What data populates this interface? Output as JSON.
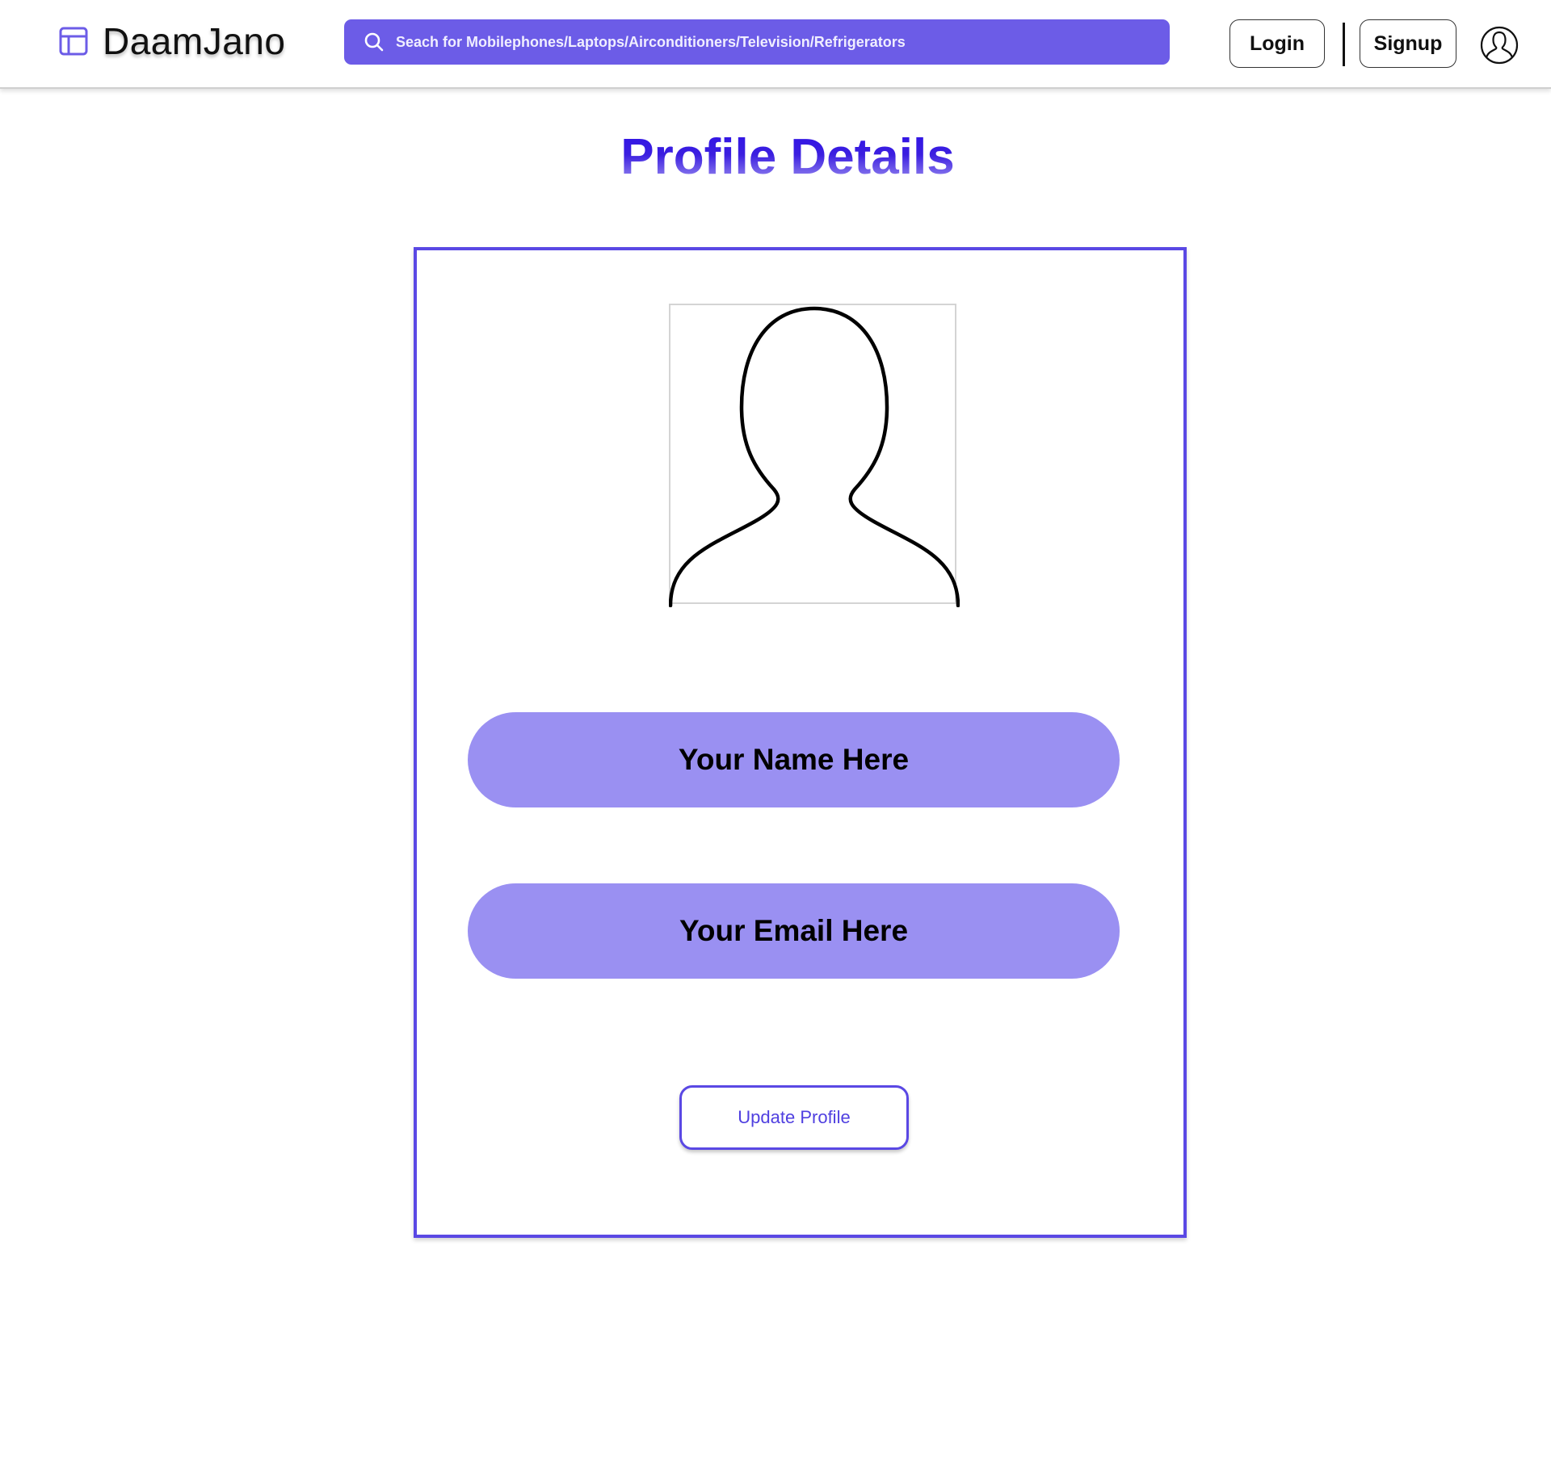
{
  "header": {
    "brand": "DaamJano",
    "brand_icon": "layout-panel-icon",
    "search": {
      "placeholder": "Seach for Mobilephones/Laptops/Airconditioners/Television/Refrigerators",
      "value": "",
      "icon": "search-icon"
    },
    "login_label": "Login",
    "signup_label": "Signup",
    "account_icon": "user-circle-icon"
  },
  "main": {
    "title": "Profile Details",
    "avatar_icon": "user-silhouette-icon",
    "name_value": "Your Name Here",
    "email_value": "Your Email Here",
    "update_label": "Update Profile"
  },
  "colors": {
    "accent": "#6c5ce7",
    "card_border": "#5a48e4",
    "pill_fill": "#9a90f2",
    "title": "#3b1fe0"
  }
}
